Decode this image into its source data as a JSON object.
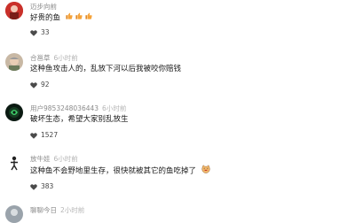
{
  "comments": [
    {
      "username": "迈步向前",
      "time": "",
      "text": "好贵的鱼",
      "emojis": [
        "thumbs-up-emoji",
        "thumbs-up-emoji",
        "thumbs-up-emoji"
      ],
      "likes": "33",
      "avatar": "avatar-red"
    },
    {
      "username": "合邕草",
      "time": "6小时前",
      "text": "这种鱼攻击人的，乱放下河以后我被咬你赔钱",
      "emojis": [],
      "likes": "92",
      "avatar": "avatar-elder"
    },
    {
      "username": "用户9853248036443",
      "time": "6小时前",
      "text": "破坏生态，希望大家别乱放生",
      "emojis": [],
      "likes": "1527",
      "avatar": "avatar-green-dark"
    },
    {
      "username": "放牛娃",
      "time": "6小时前",
      "text": "这种鱼不会野地里生存，很快就被其它的鱼吃掉了",
      "emojis": [
        "laughing-cat-emoji"
      ],
      "likes": "383",
      "avatar": "avatar-figure"
    },
    {
      "username": "聊聊今日",
      "time": "2小时前",
      "text": "",
      "emojis": [],
      "likes": "",
      "avatar": "avatar-gray"
    }
  ],
  "colors": {
    "username": "#8a8a8a",
    "time": "#b4b4b4",
    "text": "#1a1a1a",
    "like_icon": "#4a4a4a"
  }
}
